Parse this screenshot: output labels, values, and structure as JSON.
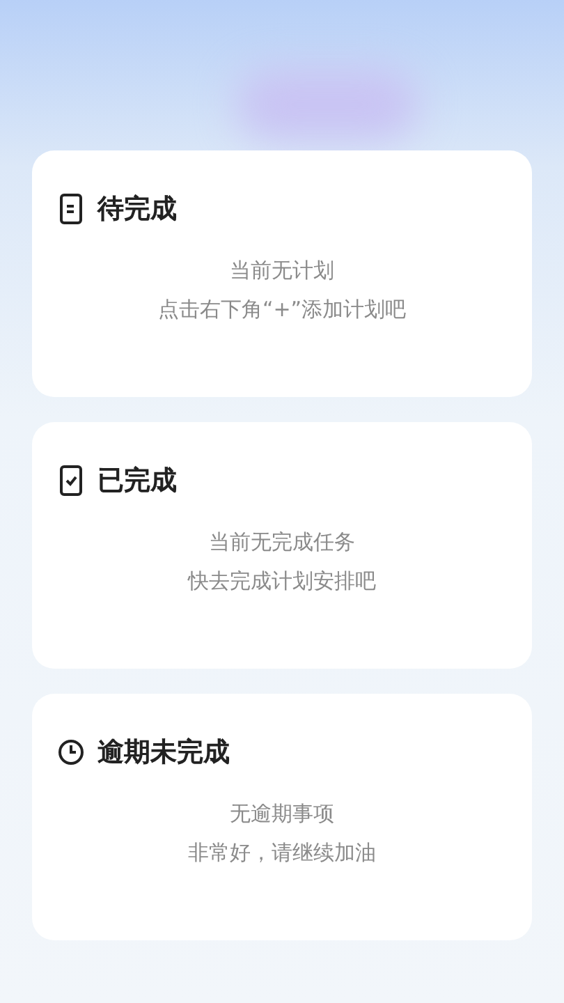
{
  "sections": [
    {
      "kind": "pending",
      "title": "待完成",
      "lines": [
        "当前无计划",
        "点击右下角“+”添加计划吧"
      ]
    },
    {
      "kind": "done",
      "title": "已完成",
      "lines": [
        "当前无完成任务",
        "快去完成计划安排吧"
      ]
    },
    {
      "kind": "overdue",
      "title": "逾期未完成",
      "lines": [
        "无逾期事项",
        "非常好，请继续加油"
      ]
    }
  ]
}
